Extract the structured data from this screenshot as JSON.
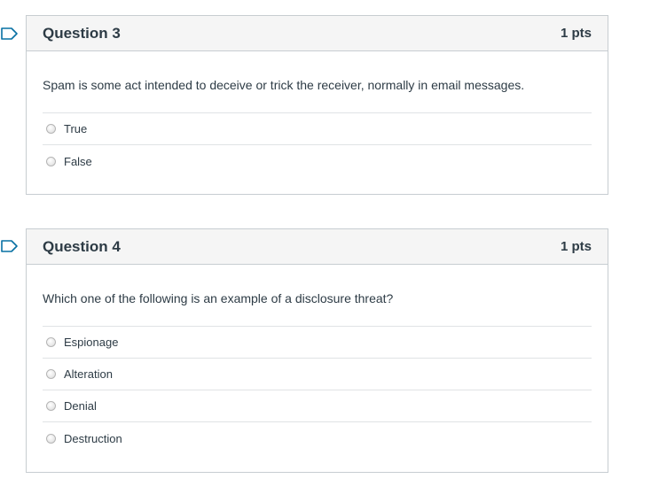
{
  "questions": [
    {
      "title": "Question 3",
      "points": "1 pts",
      "text": "Spam is some act intended to deceive or trick the receiver, normally in email messages.",
      "answers": [
        "True",
        "False"
      ]
    },
    {
      "title": "Question 4",
      "points": "1 pts",
      "text": "Which one of the following is an example of a disclosure threat?",
      "answers": [
        "Espionage",
        "Alteration",
        "Denial",
        "Destruction"
      ]
    }
  ],
  "colors": {
    "flag_outline": "#0770a3",
    "border": "#c7cdd1",
    "header_bg": "#f5f5f5",
    "text": "#2d3b45"
  },
  "icons": {
    "flag": "flag-question-icon"
  }
}
